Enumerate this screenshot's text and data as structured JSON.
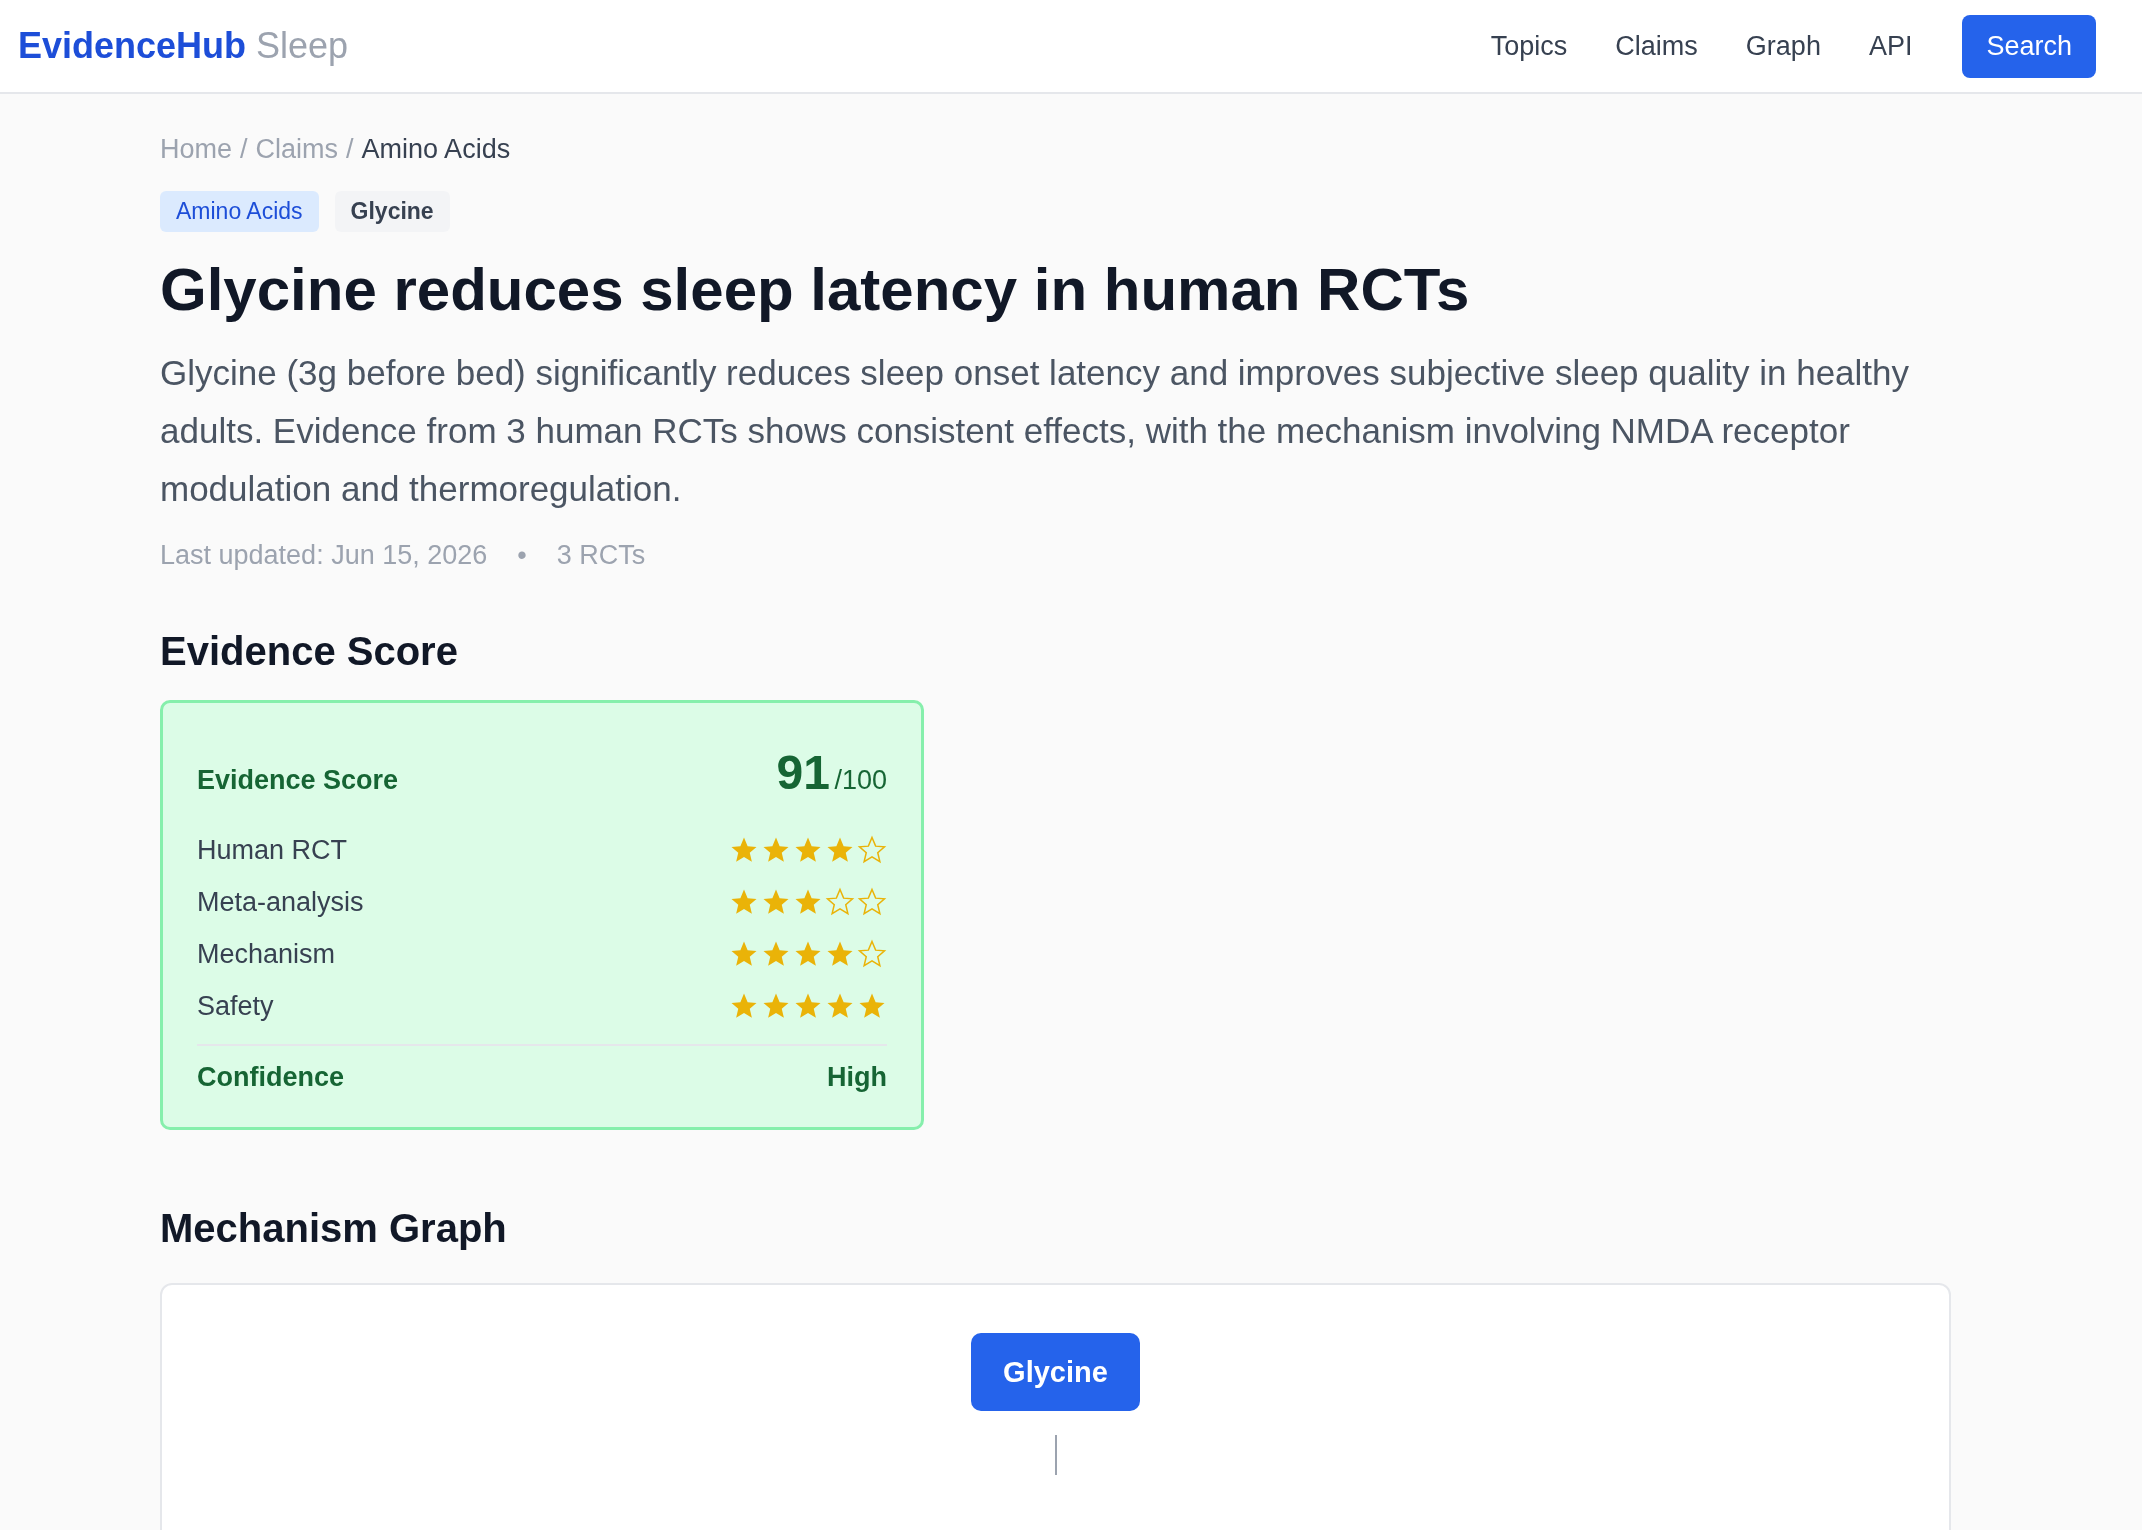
{
  "header": {
    "brand": "EvidenceHub",
    "product": "Sleep",
    "nav": [
      {
        "label": "Topics"
      },
      {
        "label": "Claims"
      },
      {
        "label": "Graph"
      },
      {
        "label": "API"
      }
    ],
    "search_button": "Search"
  },
  "breadcrumb": {
    "separator": "/",
    "items": [
      {
        "label": "Home",
        "current": false
      },
      {
        "label": "Claims",
        "current": false
      },
      {
        "label": "Amino Acids",
        "current": true
      }
    ]
  },
  "tags": [
    {
      "label": "Amino Acids",
      "kind": "category"
    },
    {
      "label": "Glycine",
      "kind": "compound"
    }
  ],
  "title": "Glycine reduces sleep latency in human RCTs",
  "description": "Glycine (3g before bed) significantly reduces sleep onset latency and improves subjective sleep quality in healthy adults. Evidence from 3 human RCTs shows consistent effects, with the mechanism involving NMDA receptor modulation and thermoregulation.",
  "meta": {
    "updated": "Last updated: Jun 15, 2026",
    "bullet": "•",
    "studies": "3 RCTs"
  },
  "evidence_section": {
    "heading": "Evidence Score",
    "card": {
      "label": "Evidence Score",
      "score": "91",
      "max": "/100",
      "rows": [
        {
          "name": "Human RCT",
          "stars": 4
        },
        {
          "name": "Meta-analysis",
          "stars": 3
        },
        {
          "name": "Mechanism",
          "stars": 4
        },
        {
          "name": "Safety",
          "stars": 5
        }
      ],
      "confidence_label": "Confidence",
      "confidence_value": "High"
    }
  },
  "graph_section": {
    "heading": "Mechanism Graph",
    "nodes": [
      {
        "label": "Glycine",
        "kind": "root"
      }
    ]
  }
}
